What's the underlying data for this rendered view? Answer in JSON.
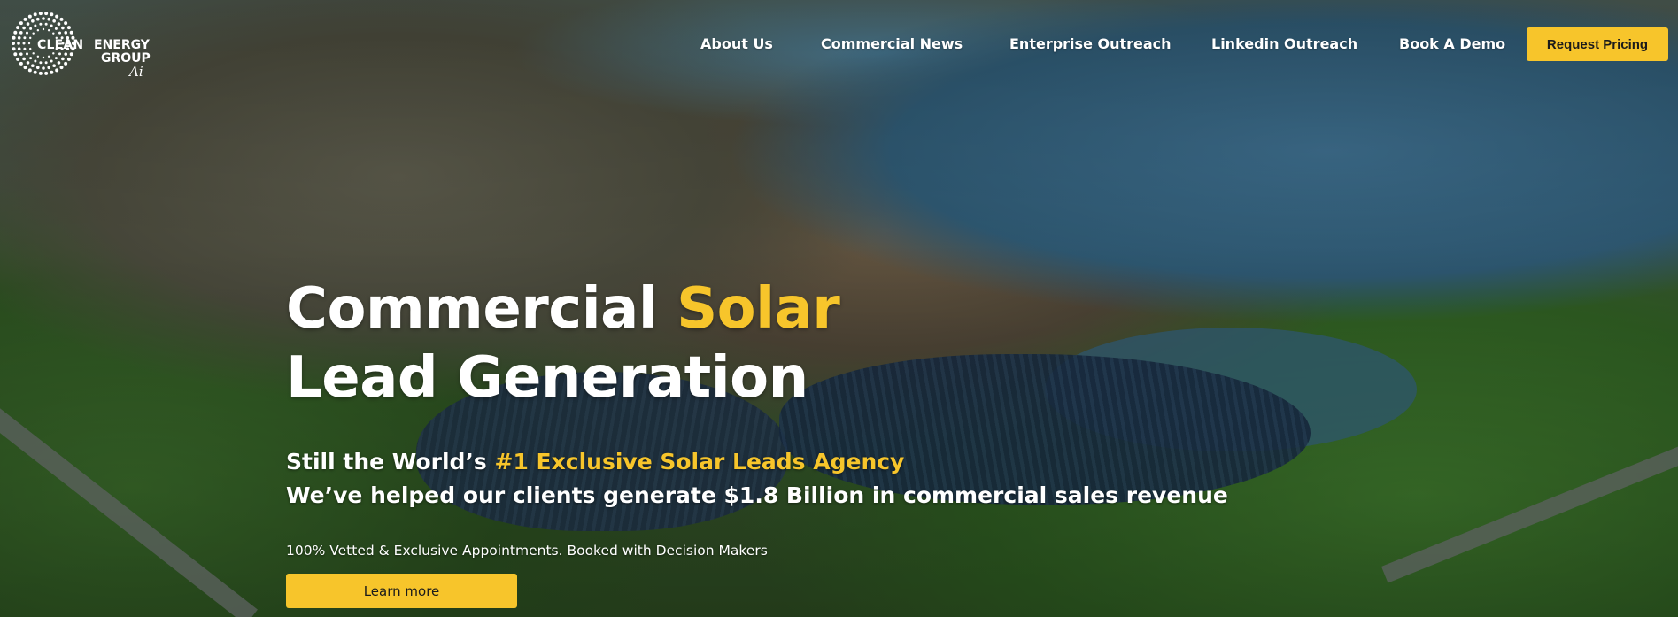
{
  "brand": {
    "line1_left": "CLEAN",
    "line1_right": "ENERGY",
    "line2": "GROUP",
    "line3": "Ai",
    "logo_icon": "dotted-circle-logo-icon"
  },
  "nav": {
    "items": [
      {
        "label": "About Us"
      },
      {
        "label": "Commercial News"
      },
      {
        "label": "Enterprise Outreach"
      },
      {
        "label": "Linkedin Outreach"
      },
      {
        "label": "Book A Demo"
      }
    ],
    "cta_label": "Request Pricing"
  },
  "hero": {
    "title_part1": "Commercial ",
    "title_accent": "Solar",
    "title_line2": "Lead Generation",
    "sub1_prefix": "Still the World’s ",
    "sub1_accent": "#1 Exclusive Solar Leads Agency",
    "sub2": "We’ve helped our clients generate $1.8 Billion in commercial sales revenue",
    "note": "100% Vetted & Exclusive Appointments. Booked with Decision Makers",
    "button_label": "Learn more"
  },
  "colors": {
    "accent": "#f7c52b",
    "text": "#ffffff"
  }
}
